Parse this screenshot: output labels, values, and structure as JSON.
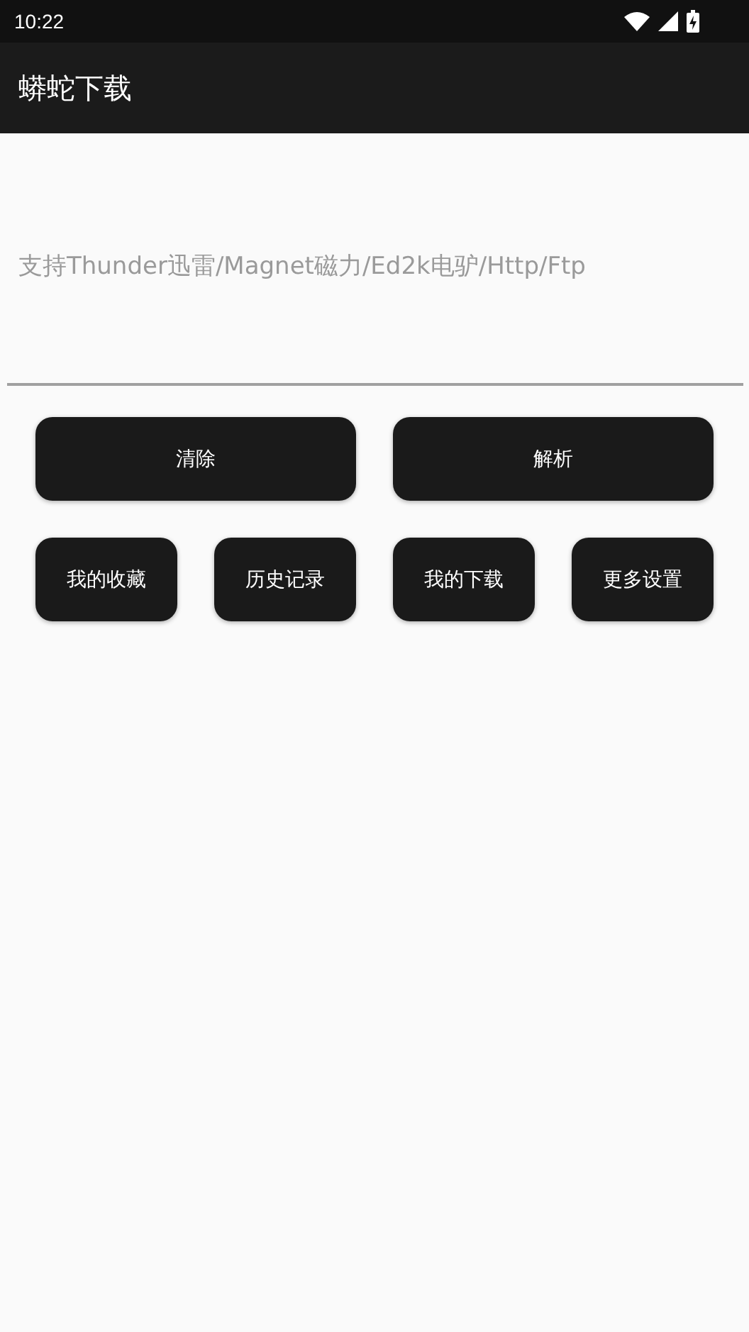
{
  "status_bar": {
    "time": "10:22"
  },
  "app_bar": {
    "title": "蟒蛇下载"
  },
  "link_field": {
    "placeholder": "支持Thunder迅雷/Magnet磁力/Ed2k电驴/Http/Ftp"
  },
  "primary_buttons": [
    "清除",
    "解析"
  ],
  "secondary_buttons": [
    "我的收藏",
    "历史记录",
    "我的下载",
    "更多设置"
  ]
}
